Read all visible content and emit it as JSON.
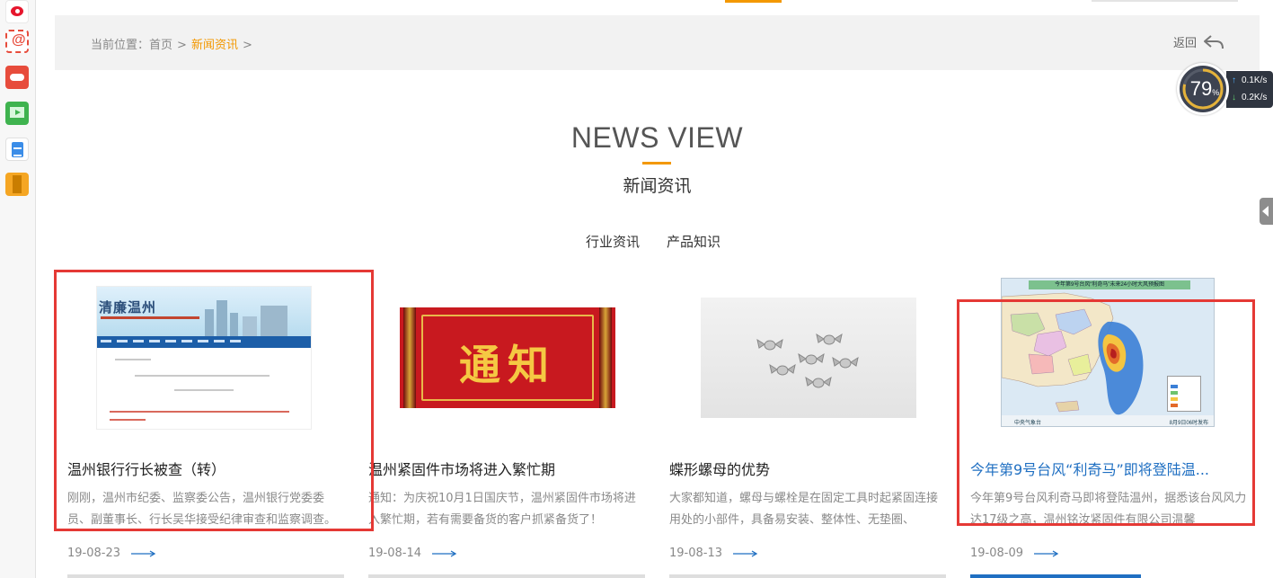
{
  "sidebar": {
    "icons": [
      "weibo-icon",
      "mail-icon",
      "game-icon",
      "video-icon",
      "document-icon",
      "bookmark-icon"
    ]
  },
  "breadcrumb": {
    "prefix": "当前位置：",
    "home": "首页",
    "separator": ">",
    "current": "新闻资讯",
    "trailing": ">"
  },
  "back_label": "返回",
  "speed_widget": {
    "percent": "79",
    "percent_unit": "%",
    "upload": "0.1K/s",
    "download": "0.2K/s"
  },
  "section": {
    "title": "NEWS VIEW",
    "subtitle": "新闻资讯"
  },
  "tabs": [
    {
      "label": "行业资讯"
    },
    {
      "label": "产品知识"
    }
  ],
  "image_text": {
    "notice": "通知",
    "site_logo": "清廉温州",
    "typhoon_caption": "今年第9号台风“利奇马”未来24小时大风预报图",
    "typhoon_source": "中央气象台",
    "typhoon_time": "8月9日06时发布"
  },
  "news": [
    {
      "title": "温州银行行长被查（转）",
      "summary": "刚刚，温州市纪委、监察委公告，温州银行党委委员、副董事长、行长吴华接受纪律审查和监察调查。",
      "date": "19-08-23",
      "image": "website-screenshot",
      "highlighted": true
    },
    {
      "title": "温州紧固件市场将进入繁忙期",
      "summary": "通知：为庆祝10月1日国庆节，温州紧固件市场将进 入繁忙期，若有需要备货的客户抓紧备货了！",
      "date": "19-08-14",
      "image": "notice-banner",
      "highlighted": false
    },
    {
      "title": "蝶形螺母的优势",
      "summary": "大家都知道，螺母与螺栓是在固定工具时起紧固连接用处的小部件，具备易安装、整体性、无垫圈、",
      "date": "19-08-13",
      "image": "wing-nuts-photo",
      "highlighted": false
    },
    {
      "title": "今年第9号台风“利奇马”即将登陆温...",
      "summary": "今年第9号台风利奇马即将登陆温州，据悉该台风风力达17级之高，温州铭汝紧固件有限公司温馨",
      "date": "19-08-09",
      "image": "typhoon-map",
      "highlighted": true
    }
  ],
  "colors": {
    "accent": "#f39800",
    "link_blue": "#1f6fc2",
    "highlight_red": "#e53935",
    "breadcrumb_bg": "#f2f2f2"
  }
}
